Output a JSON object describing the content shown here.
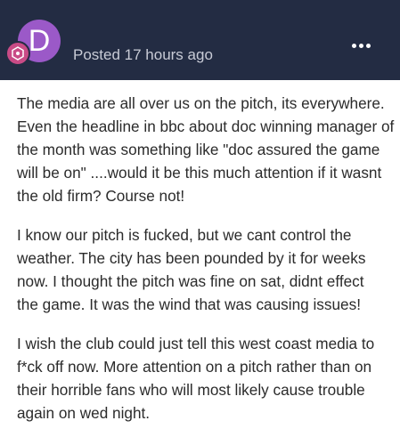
{
  "header": {
    "avatar_letter": "D",
    "posted_text": "Posted 17 hours ago",
    "colors": {
      "background": "#232c43",
      "avatar": "#9b59c8",
      "badge": "#c94b86"
    },
    "icons": [
      "avatar",
      "rank-badge-icon",
      "more-options-icon"
    ]
  },
  "post": {
    "paragraphs": [
      [
        "The media are all over us on the pitch, its everywhere.",
        "Even the headline in bbc about doc winning manager of",
        "the month was something like \"doc assured the game",
        "will be on\" ....would it be this much attention if it wasnt",
        "the old firm? Course not!"
      ],
      [
        "I know our pitch is fucked, but we cant control the",
        "weather. The city has been pounded by it for weeks",
        "now. I thought the pitch was fine on sat, didnt effect",
        "the game. It was the wind that was causing issues!"
      ],
      [
        "I wish the club could just tell this west coast media to",
        "f*ck off now. More attention on a pitch rather than on",
        "their horrible fans who will most likely cause trouble",
        "again on wed night."
      ]
    ]
  }
}
